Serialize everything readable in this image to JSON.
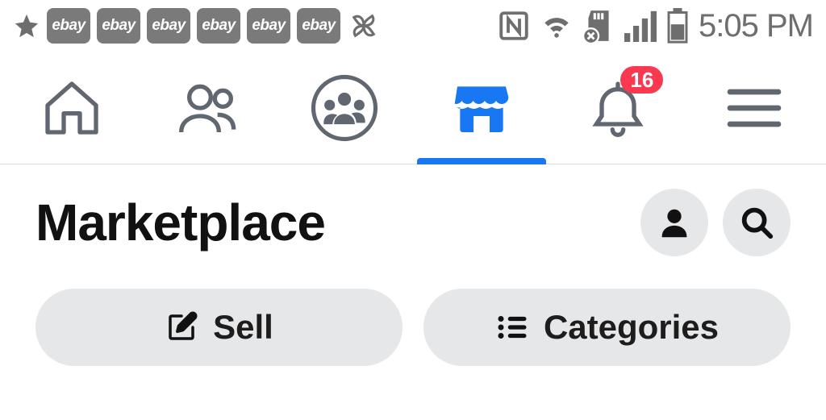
{
  "status": {
    "ebay_label": "ebay",
    "ebay_count": 6,
    "time": "5:05 PM"
  },
  "nav": {
    "notification_count": "16",
    "active_tab": "marketplace"
  },
  "header": {
    "title": "Marketplace"
  },
  "pills": {
    "sell": "Sell",
    "categories": "Categories"
  }
}
